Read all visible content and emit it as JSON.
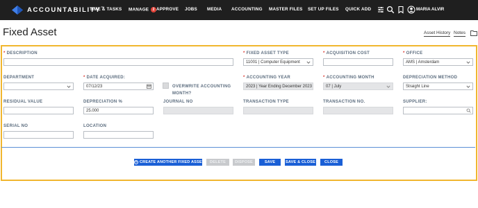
{
  "nav": {
    "brand": "ACCOUNTABILITY",
    "brand_mark": "™",
    "items": [
      "TIME & TASKS",
      "MANAGE",
      "APPROVE",
      "JOBS",
      "MEDIA",
      "ACCOUNTING",
      "MASTER FILES",
      "SET UP FILES",
      "QUICK ADD"
    ],
    "manage_badge": "2",
    "user": "MARIA ALVIR",
    "icons": [
      "sliders-icon",
      "search-icon",
      "bookmark-icon",
      "user-icon"
    ]
  },
  "header": {
    "title": "Fixed Asset",
    "asset_history": "Asset History",
    "notes": "Notes"
  },
  "form": {
    "description": {
      "label": "DESCRIPTION",
      "value": ""
    },
    "fixed_asset_type": {
      "label": "FIXED ASSET TYPE",
      "value": "11001 | Computer Equipment"
    },
    "acquisition_cost": {
      "label": "ACQUISITION COST",
      "value": ""
    },
    "office": {
      "label": "OFFICE",
      "value": "AMS | Amsterdam"
    },
    "department": {
      "label": "DEPARTMENT",
      "value": ""
    },
    "date_acquired": {
      "label": "DATE ACQUIRED:",
      "value": "07/12/23"
    },
    "overwrite": {
      "label_line1": "OVERWRITE ACCOUNTING",
      "label_line2": "MONTH?"
    },
    "accounting_year": {
      "label": "ACCOUNTING YEAR",
      "value": "2023 | Year Ending December 2023"
    },
    "accounting_month": {
      "label": "ACCOUNTING MONTH",
      "value": "07 | July"
    },
    "depreciation_method": {
      "label": "DEPRECIATION METHOD",
      "value": "Straight Line"
    },
    "residual_value": {
      "label": "RESIDUAL VALUE",
      "value": ""
    },
    "depreciation_pct": {
      "label": "DEPRECIATION %",
      "value": "25.000"
    },
    "journal_no": {
      "label": "JOURNAL NO",
      "value": ""
    },
    "transaction_type": {
      "label": "TRANSACTION TYPE",
      "value": ""
    },
    "transaction_no": {
      "label": "TRANSACTION NO.",
      "value": ""
    },
    "supplier": {
      "label": "SUPPLIER:",
      "value": ""
    },
    "serial_no": {
      "label": "SERIAL NO",
      "value": ""
    },
    "location": {
      "label": "LOCATION",
      "value": ""
    }
  },
  "buttons": {
    "create_another": "CREATE ANOTHER FIXED ASSET",
    "delete": "DELETE",
    "dispose": "DISPOSE",
    "save": "SAVE",
    "save_close": "SAVE & CLOSE",
    "close": "CLOSE"
  },
  "colors": {
    "nav_bg": "#1f1f1f",
    "accent_blue": "#1a5fd6",
    "panel_border": "#f1b62e",
    "required": "#d9342b",
    "badge": "#e2443a"
  }
}
